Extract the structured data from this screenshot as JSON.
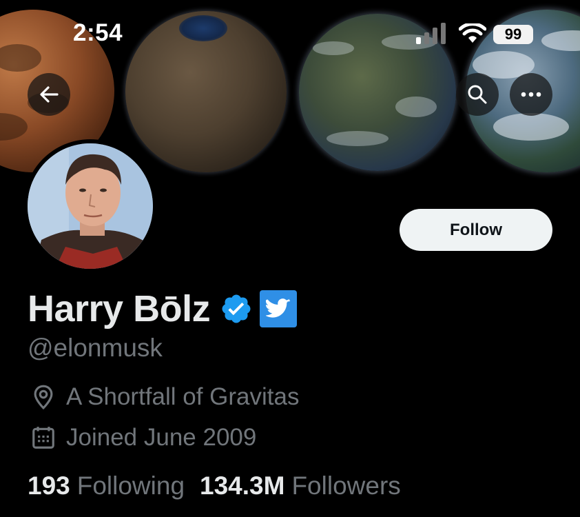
{
  "status_bar": {
    "time": "2:54",
    "battery": "99"
  },
  "icons": {
    "back": "arrow-left-icon",
    "search": "search-icon",
    "more": "more-horizontal-icon",
    "verified": "verified-badge-icon",
    "twitter": "twitter-bird-icon",
    "location": "location-pin-icon",
    "calendar": "calendar-icon"
  },
  "profile": {
    "follow_label": "Follow",
    "display_name": "Harry Bōlz",
    "handle": "@elonmusk",
    "location": "A Shortfall of Gravitas",
    "joined": "Joined June 2009",
    "following_count": "193",
    "following_label": "Following",
    "followers_count": "134.3M",
    "followers_label": "Followers"
  },
  "colors": {
    "background": "#000000",
    "primary_text": "#e7e9ea",
    "secondary_text": "#71767b",
    "verified_blue": "#1d9bf0",
    "follow_button_bg": "#eff3f4"
  }
}
